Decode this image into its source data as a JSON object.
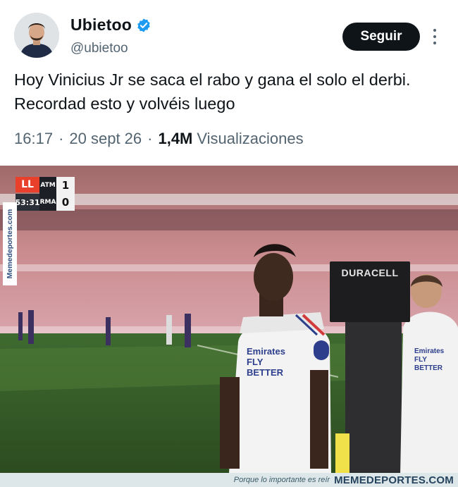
{
  "author": {
    "display_name": "Ubietoo",
    "handle": "@ubietoo",
    "verified": true,
    "avatar_icon": "profile-photo"
  },
  "actions": {
    "follow_label": "Seguir",
    "more_icon": "more-vertical-icon"
  },
  "tweet": {
    "text": "Hoy Vinicius Jr se saca el rabo y gana el solo el derbi. Recordad esto y volvéis luego",
    "time": "16:17",
    "date": "20 sept 26",
    "separator": "·",
    "views_count": "1,4M",
    "views_label": "Visualizaciones"
  },
  "media": {
    "scorebug": {
      "league_logo": "LL",
      "clock": "53:31",
      "team_home": "ATM",
      "team_away": "RMA",
      "score_home": "1",
      "score_away": "0"
    },
    "side_watermark": "Memedeportes.com",
    "billboard": "DURACELL",
    "jersey_sponsor": "Emirates FLY BETTER",
    "jersey_sponsor_2": "Emirates FLY BETTER"
  },
  "footer": {
    "slogan": "Porque lo importante es reír",
    "brand": "MEMEDEPORTES.COM"
  },
  "colors": {
    "follow_bg": "#0f1419",
    "verified_blue": "#1d9bf0",
    "muted_text": "#536471"
  }
}
